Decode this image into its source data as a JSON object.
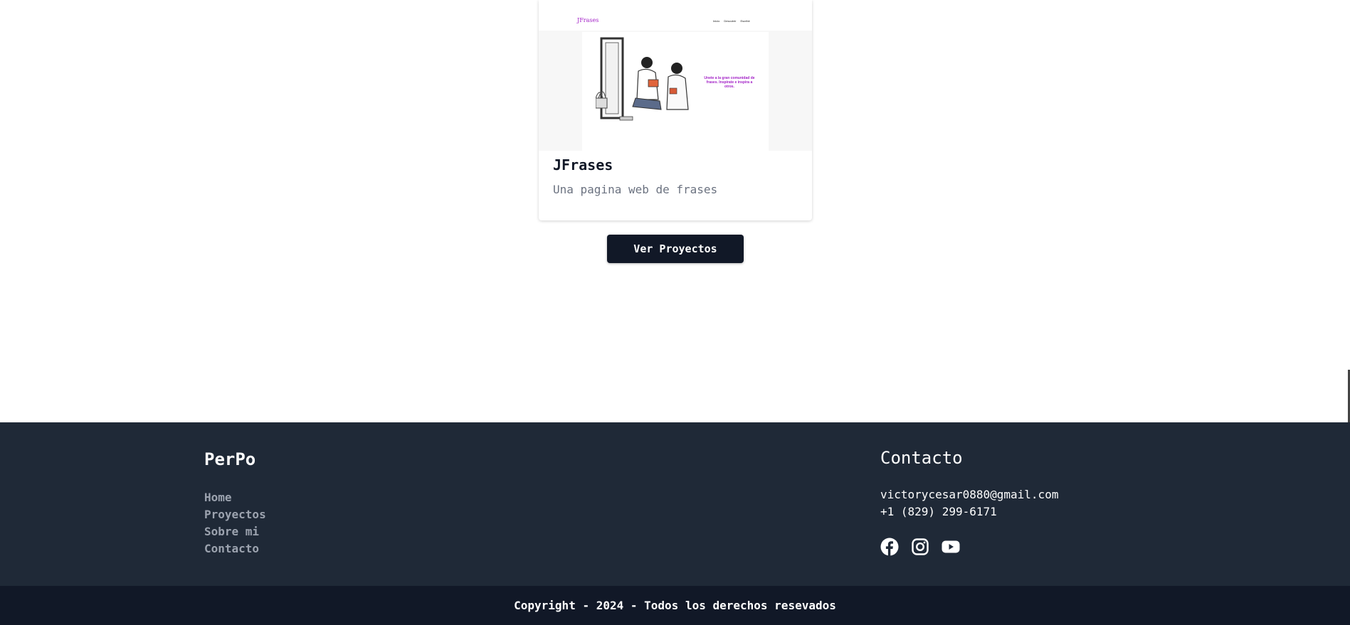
{
  "project_card": {
    "thumbnail": {
      "logo": "JFrases",
      "nav_links": [
        "Inicio",
        "Descubrir",
        "Escribir"
      ],
      "tagline": "Unete a la gran comunidad de frases. Inspírate e inspira a otros."
    },
    "title": "JFrases",
    "description": "Una pagina web de frases"
  },
  "projects_button": {
    "label": "Ver Proyectos"
  },
  "footer": {
    "brand": "PerPo",
    "nav": [
      {
        "label": "Home"
      },
      {
        "label": "Proyectos"
      },
      {
        "label": "Sobre mi"
      },
      {
        "label": "Contacto"
      }
    ],
    "contact": {
      "title": "Contacto",
      "email": "victorycesar0880@gmail.com",
      "phone": "+1 (829) 299-6171"
    },
    "socials": [
      {
        "icon": "facebook-icon"
      },
      {
        "icon": "instagram-icon"
      },
      {
        "icon": "youtube-icon"
      }
    ],
    "copyright": "Copyright - 2024 - Todos los derechos resevados"
  },
  "colors": {
    "footer_bg": "#1f2937",
    "copyright_bg": "#111827",
    "button_bg": "#111827",
    "accent_purple": "#a321c7"
  }
}
